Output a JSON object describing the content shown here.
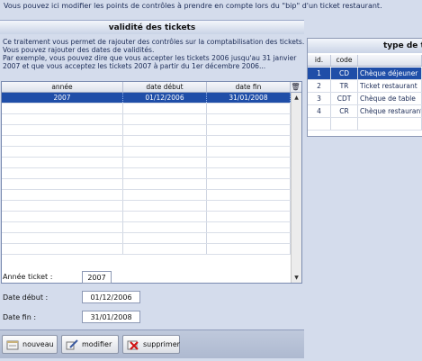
{
  "intro": "Vous pouvez ici modifier les points de contrôles à prendre en compte lors du \"bip\" d'un ticket restaurant.",
  "left_panel": {
    "title": "validité des tickets",
    "description": [
      "Ce traitement vous permet de rajouter des contrôles sur la comptabilisation des tickets.",
      "Vous pouvez rajouter des dates de validités.",
      "Par exemple, vous pouvez dire que vous accepter les tickets 2006 jusqu'au 31 janvier",
      "2007 et que vous acceptez les tickets 2007 à partir du 1er décembre 2006..."
    ],
    "columns": [
      "année",
      "date début",
      "date fin"
    ],
    "rows": [
      {
        "annee": "2007",
        "debut": "01/12/2006",
        "fin": "31/01/2008",
        "selected": true
      }
    ],
    "empty_rows": 14
  },
  "form": {
    "annee_label": "Année ticket :",
    "annee_value": "2007",
    "debut_label": "Date début :",
    "debut_value": "01/12/2006",
    "fin_label": "Date fin :",
    "fin_value": "31/01/2008"
  },
  "buttons": {
    "new_label": "nouveau",
    "edit_label": "modifier",
    "delete_label": "supprimer"
  },
  "right_panel": {
    "title": "type de t",
    "columns": [
      "id.",
      "code",
      ""
    ],
    "rows": [
      {
        "id": "1",
        "code": "CD",
        "libelle": "Chèque déjeuner",
        "selected": true
      },
      {
        "id": "2",
        "code": "TR",
        "libelle": "Ticket restaurant",
        "selected": false
      },
      {
        "id": "3",
        "code": "CDT",
        "libelle": "Chèque de table",
        "selected": false
      },
      {
        "id": "4",
        "code": "CR",
        "libelle": "Chèque restaurant",
        "selected": false
      }
    ]
  },
  "colors": {
    "background": "#d4dcec",
    "selection": "#1f4ea8",
    "text": "#1a2a55"
  },
  "icons": {
    "delete_column": "trash-icon",
    "new": "new-record-icon",
    "edit": "edit-icon",
    "delete": "delete-icon",
    "scroll_up": "arrow-up-icon",
    "scroll_down": "arrow-down-icon"
  }
}
